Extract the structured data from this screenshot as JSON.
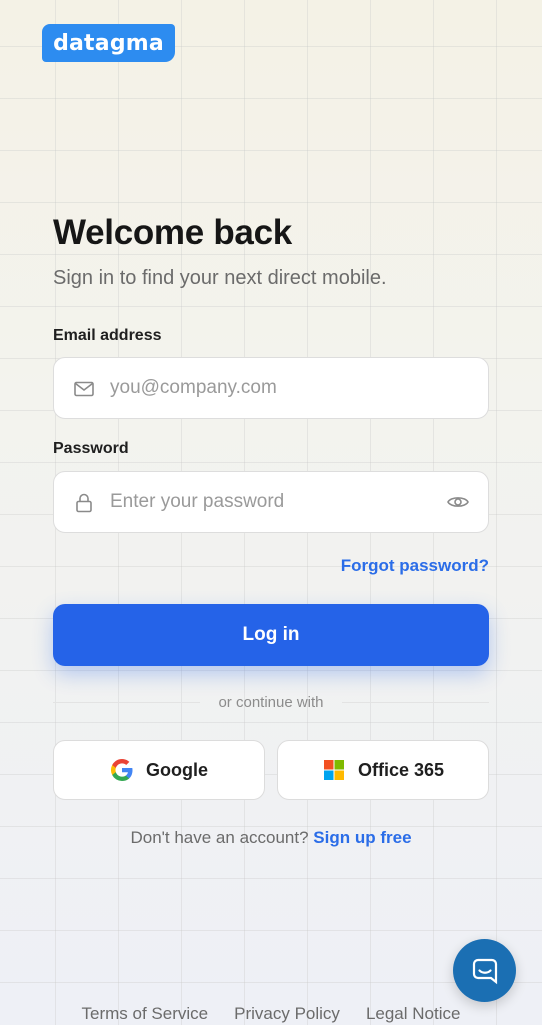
{
  "logo": {
    "text": "datagma"
  },
  "header": {
    "title": "Welcome back",
    "subtitle": "Sign in to find your next direct mobile."
  },
  "form": {
    "email": {
      "label": "Email address",
      "placeholder": "you@company.com",
      "value": "",
      "icon": "mail-icon"
    },
    "password": {
      "label": "Password",
      "placeholder": "Enter your password",
      "value": "",
      "icon": "lock-icon",
      "toggle_icon": "eye-icon"
    },
    "forgot_label": "Forgot password?",
    "login_label": "Log in",
    "divider_text": "or continue with"
  },
  "oauth": {
    "google_label": "Google",
    "office_label": "Office 365"
  },
  "signup": {
    "prompt": "Don't have an account?",
    "link": "Sign up free"
  },
  "footer": {
    "terms": "Terms of Service",
    "privacy": "Privacy Policy",
    "legal": "Legal Notice"
  },
  "colors": {
    "brand": "#2d8cf0",
    "primary": "#2563e8",
    "link": "#2b6de8",
    "chat": "#1b6fb3"
  }
}
